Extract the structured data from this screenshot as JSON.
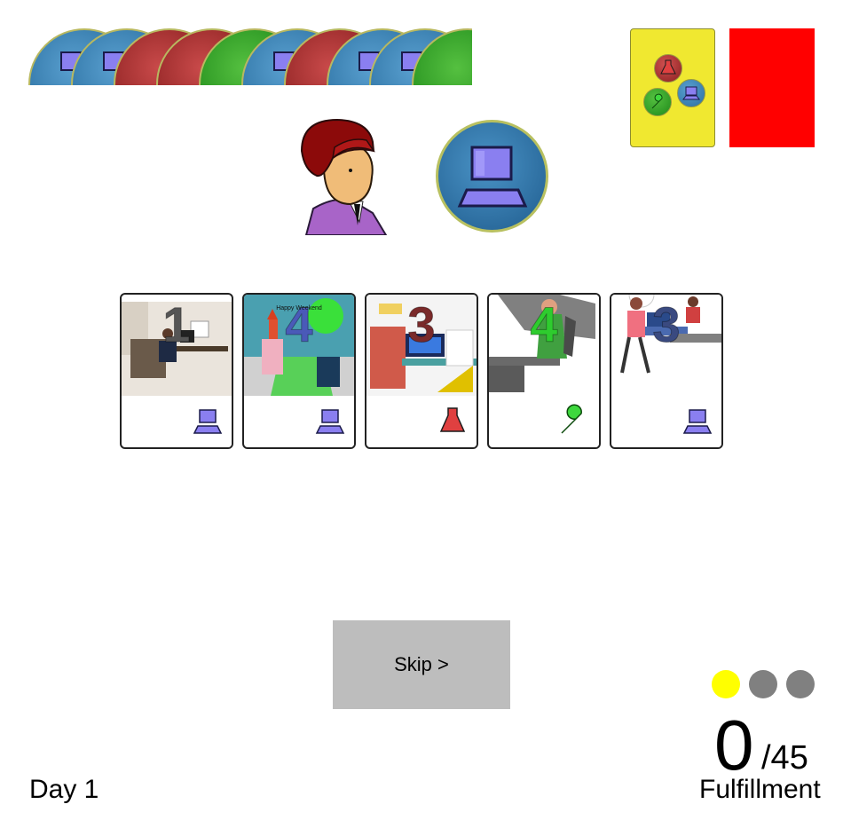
{
  "queue": {
    "tokens": [
      "computer",
      "computer",
      "science",
      "science",
      "engineering",
      "computer",
      "science",
      "computer",
      "computer",
      "engineering"
    ]
  },
  "customer": {
    "request": "computer"
  },
  "hand": {
    "cards": [
      {
        "value": "1",
        "type": "computer",
        "number_color": "#555555"
      },
      {
        "value": "4",
        "type": "computer",
        "number_color": "#4a5ab8",
        "caption": "Happy Weekend"
      },
      {
        "value": "3",
        "type": "science",
        "number_color": "#7a2a2a"
      },
      {
        "value": "4",
        "type": "engineering",
        "number_color": "#2ecc2e"
      },
      {
        "value": "3",
        "type": "computer",
        "number_color": "#3a4a80"
      }
    ]
  },
  "skip_button": {
    "label": "Skip >"
  },
  "status_dots": [
    "#ffff00",
    "#808080",
    "#808080"
  ],
  "score": {
    "value": "0",
    "total": "/45",
    "label": "Fulfillment"
  },
  "day": {
    "label": "Day 1"
  }
}
